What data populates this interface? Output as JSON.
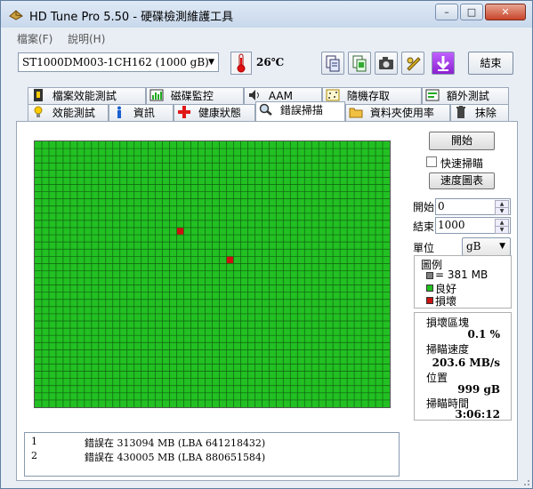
{
  "window": {
    "title": "HD Tune Pro 5.50 - 硬碟檢測維護工具"
  },
  "menu": [
    "檔案(F)",
    "說明(H)"
  ],
  "toolbar": {
    "drive": "ST1000DM003-1CH162 (1000 gB)",
    "temperature": "26℃",
    "exit_label": "結束",
    "buttons": [
      "copy-text-icon",
      "copy-all-icon",
      "camera-icon",
      "settings-icon",
      "download-icon"
    ]
  },
  "tabs_top": [
    {
      "label": "檔案效能測試",
      "icon": "file-benchmark-icon"
    },
    {
      "label": "磁碟監控",
      "icon": "disk-monitor-icon"
    },
    {
      "label": "AAM",
      "icon": "speaker-icon"
    },
    {
      "label": "隨機存取",
      "icon": "random-access-icon"
    },
    {
      "label": "額外測試",
      "icon": "extra-tests-icon"
    }
  ],
  "tabs_bottom": [
    {
      "label": "效能測試",
      "icon": "benchmark-icon"
    },
    {
      "label": "資訊",
      "icon": "info-icon"
    },
    {
      "label": "健康狀態",
      "icon": "health-icon"
    },
    {
      "label": "錯誤掃描",
      "icon": "error-scan-icon",
      "active": true
    },
    {
      "label": "資料夾使用率",
      "icon": "folder-usage-icon"
    },
    {
      "label": "抹除",
      "icon": "erase-icon"
    }
  ],
  "controls": {
    "start_button": "開始",
    "quick_scan_label": "快速掃瞄",
    "quick_scan_checked": false,
    "speed_map_button": "速度圖表",
    "start_label": "開始",
    "start_value": "0",
    "end_label": "結束",
    "end_value": "1000",
    "unit_label": "單位",
    "unit_value": "gB"
  },
  "legend": {
    "title": "圖例",
    "block_size": "= 381 MB",
    "good": "良好",
    "bad": "損壞",
    "colors": {
      "block": "#808080",
      "good": "#22c022",
      "bad": "#cc1111"
    }
  },
  "stats": {
    "damaged_label": "損壞區塊",
    "damaged_value": "0.1 %",
    "speed_label": "掃瞄速度",
    "speed_value": "203.6 MB/s",
    "position_label": "位置",
    "position_value": "999 gB",
    "time_label": "掃瞄時間",
    "time_value": "3:06:12"
  },
  "scan_map": {
    "columns": 50,
    "rows": 37,
    "bad_blocks": [
      {
        "row": 12,
        "col": 20
      },
      {
        "row": 16,
        "col": 27
      }
    ]
  },
  "error_log": [
    {
      "index": "1",
      "text": "錯誤在 313094 MB (LBA 641218432)"
    },
    {
      "index": "2",
      "text": "錯誤在 430005 MB (LBA 880651584)"
    }
  ]
}
